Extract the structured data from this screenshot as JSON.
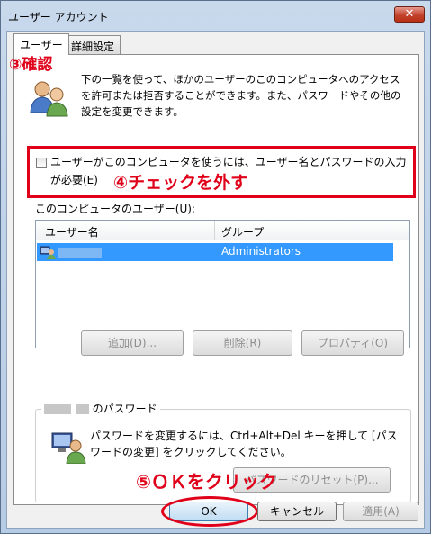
{
  "window": {
    "title": "ユーザー アカウント",
    "close_label": "✕"
  },
  "tabs": [
    {
      "label": "ユーザー"
    },
    {
      "label": "詳細設定"
    }
  ],
  "annotations": {
    "step3": "③確認",
    "step4": "④チェックを外す",
    "step5": "⑤ＯＫをクリック"
  },
  "intro_text": "下の一覧を使って、ほかのユーザーのこのコンピュータへのアクセスを許可または拒否することができます。また、パスワードやその他の設定を変更できます。",
  "require_password": {
    "label": "ユーザーがこのコンピュータを使うには、ユーザー名とパスワードの入力が必要(E)",
    "checked": false
  },
  "users_list": {
    "label": "このコンピュータのユーザー(U):",
    "columns": [
      "ユーザー名",
      "グループ"
    ],
    "rows": [
      {
        "group": "Administrators",
        "selected": true
      }
    ]
  },
  "list_buttons": {
    "add": "追加(D)...",
    "remove": "削除(R)",
    "properties": "プロパティ(O)"
  },
  "password_group": {
    "title_suffix": "のパスワード",
    "text": "パスワードを変更するには、Ctrl+Alt+Del キーを押して [パスワードの変更] をクリックしてください。",
    "reset_button": "パスワードのリセット(P)..."
  },
  "dialog_buttons": {
    "ok": "OK",
    "cancel": "キャンセル",
    "apply": "適用(A)"
  },
  "colors": {
    "annotation_red": "#e0001a",
    "selection_blue": "#3399ff"
  }
}
